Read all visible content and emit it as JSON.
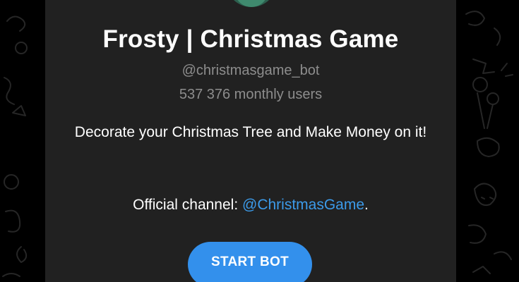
{
  "bot": {
    "name": "Frosty | Christmas Game",
    "username": "@christmasgame_bot",
    "monthly_users": "537 376 monthly users",
    "description": "Decorate your Christmas Tree and Make Money on it!",
    "channel_label": "Official channel: ",
    "channel_link": "@ChristmasGame",
    "channel_suffix": ".",
    "avatar_icon": "bot-avatar"
  },
  "actions": {
    "start_label": "START BOT"
  },
  "colors": {
    "page_background": "#000000",
    "card_background": "#212121",
    "accent": "#3390ec",
    "link": "#3c9bea",
    "secondary_text": "#8d8d8d"
  }
}
